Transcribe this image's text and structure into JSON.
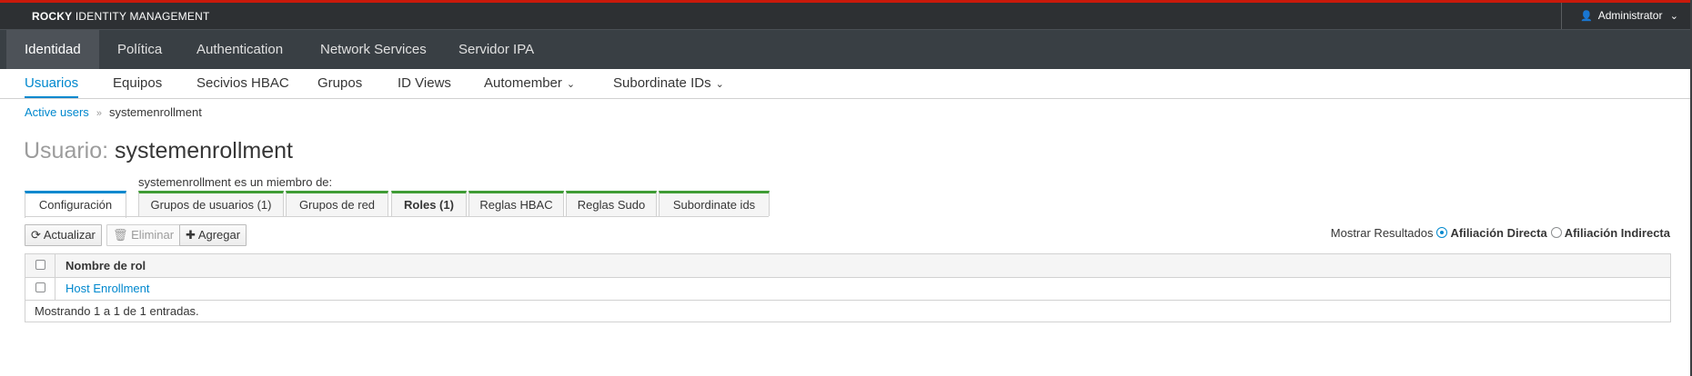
{
  "masthead": {
    "brand_bold": "ROCKY",
    "brand_rest": "IDENTITY MANAGEMENT",
    "user_label": "Administrator",
    "user_icon": "user-icon",
    "caret": "⌄"
  },
  "nav": {
    "items": [
      {
        "label": "Identidad",
        "active": true
      },
      {
        "label": "Política"
      },
      {
        "label": "Authentication"
      },
      {
        "label": "Network Services"
      },
      {
        "label": "Servidor IPA"
      }
    ]
  },
  "subnav": {
    "items": [
      {
        "label": "Usuarios",
        "active": true
      },
      {
        "label": "Equipos"
      },
      {
        "label": "Secivios HBAC"
      },
      {
        "label": "Grupos"
      },
      {
        "label": "ID Views"
      },
      {
        "label": "Automember",
        "dropdown": true
      },
      {
        "label": "Subordinate IDs",
        "dropdown": true
      }
    ]
  },
  "breadcrumb": {
    "parent": "Active users",
    "separator": "»",
    "current": "systemenrollment"
  },
  "title": {
    "label": "Usuario:",
    "name": "systemenrollment"
  },
  "member_of_label": "systemenrollment es un miembro de:",
  "tabs": [
    {
      "label": "Configuración",
      "active": true
    },
    {
      "label": "Grupos de usuarios (1)"
    },
    {
      "label": "Grupos de red"
    },
    {
      "label": "Roles (1)",
      "selected": true
    },
    {
      "label": "Reglas HBAC"
    },
    {
      "label": "Reglas Sudo"
    },
    {
      "label": "Subordinate ids"
    }
  ],
  "toolbar": {
    "refresh": "Actualizar",
    "delete": "Eliminar",
    "add": "Agregar"
  },
  "results": {
    "label": "Mostrar Resultados",
    "direct": "Afiliación Directa",
    "indirect": "Afiliación Indirecta",
    "selected": "direct"
  },
  "table": {
    "column": "Nombre de rol",
    "rows": [
      "Host Enrollment"
    ],
    "footer": "Mostrando 1 a 1 de 1 entradas."
  },
  "colors": {
    "accent": "#0088ce",
    "alert_bar": "#c9190b",
    "tab_green": "#3f9c35"
  }
}
